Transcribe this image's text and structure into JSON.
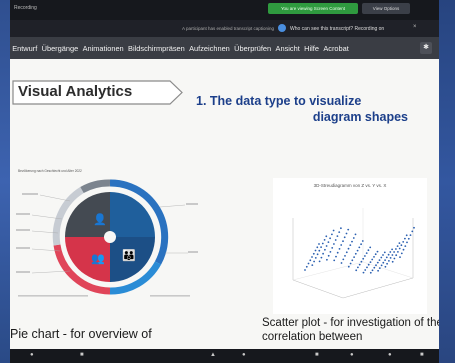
{
  "meeting": {
    "name": "Recording",
    "recording_banner": "You are viewing Screen Content",
    "view_options": "View Options",
    "notice_left": "A participant has enabled transcript captioning",
    "notice_right": "Who can see this transcript? Recording on",
    "notice_close": "×"
  },
  "ribbon": {
    "items": [
      "Entwurf",
      "Übergänge",
      "Animationen",
      "Bildschirmpräsen",
      "Aufzeichnen",
      "Überprüfen",
      "Ansicht",
      "Hilfe",
      "Acrobat"
    ]
  },
  "slide": {
    "title": "Visual Analytics",
    "heading_line1": "1.  The data type to visualize",
    "heading_line2": "diagram shapes",
    "pie_caption": "Pie chart - for overview of",
    "scatter_caption": "Scatter plot - for investigation of the correlation between",
    "pie_header": "Bevölkerung nach Geschlecht und Alter 2022",
    "scatter_title": "3D-Streudiagramm von Z vs. Y vs. X"
  },
  "colors": {
    "title_blue": "#1c3f8a",
    "ribbon_bg": "#3a3d44",
    "record_green": "#2f9a3f",
    "pie_red": "#d5344a",
    "pie_blue": "#1f5f9c",
    "pie_gray": "#9aa0a8",
    "pie_dark": "#444a52",
    "scatter_blue": "#2a5fb0"
  }
}
